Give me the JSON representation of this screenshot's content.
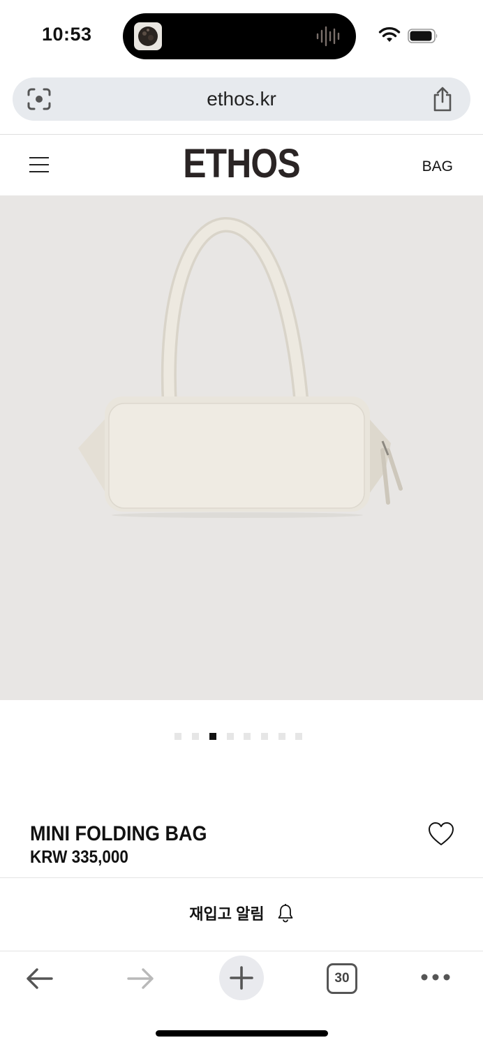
{
  "status_bar": {
    "time": "10:53"
  },
  "address_bar": {
    "url": "ethos.kr"
  },
  "header": {
    "logo": "ETHOS",
    "category_link": "BAG"
  },
  "product": {
    "name": "MINI FOLDING BAG",
    "price": "KRW 335,000",
    "image_count": 8,
    "active_image_index": 2,
    "restock_label": "재입고 알림"
  },
  "toolbar": {
    "tab_count": "30"
  },
  "icons": {
    "menu": "hamburger-menu-icon",
    "heart": "heart-icon",
    "bell": "bell-icon",
    "share": "share-icon",
    "camera": "visual-search-icon",
    "back": "arrow-left-icon",
    "forward": "arrow-right-icon",
    "new_tab": "plus-icon",
    "more": "more-icon"
  }
}
